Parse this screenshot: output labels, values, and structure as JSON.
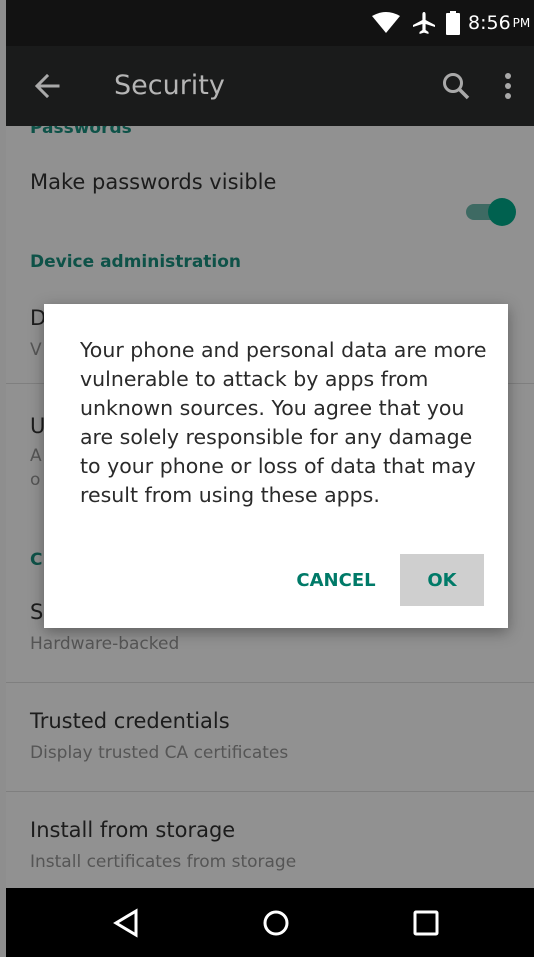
{
  "status_bar": {
    "time": "8:56",
    "ampm": "PM",
    "icons": [
      "wifi-icon",
      "airplane-mode-icon",
      "battery-icon"
    ]
  },
  "app_bar": {
    "title": "Security",
    "icons": [
      "back-arrow-icon",
      "search-icon",
      "more-vert-icon"
    ]
  },
  "settings": {
    "section_passwords": "Passwords",
    "make_passwords_visible": {
      "title": "Make passwords visible",
      "enabled": true
    },
    "section_device_admin": "Device administration",
    "device_admin_title_partial": "D",
    "device_admin_sub_partial": "V",
    "unknown_sources_title_partial": "U",
    "unknown_sources_sub_line1_partial": "A",
    "unknown_sources_sub_line2_partial": "o",
    "section_credential_partial": "C",
    "storage_type": {
      "title_partial": "S",
      "subtitle": "Hardware-backed"
    },
    "trusted_credentials": {
      "title": "Trusted credentials",
      "subtitle": "Display trusted CA certificates"
    },
    "install_from_storage": {
      "title": "Install from storage",
      "subtitle": "Install certificates from storage"
    }
  },
  "dialog": {
    "message": "Your phone and personal data are more vulnerable to attack by apps from unknown sources. You agree that you are solely responsible for any damage to your phone or loss of data that may result from using these apps.",
    "cancel_label": "CANCEL",
    "ok_label": "OK"
  },
  "nav_bar": {
    "icons": [
      "nav-back-icon",
      "nav-home-icon",
      "nav-recents-icon"
    ]
  },
  "colors": {
    "accent": "#009688",
    "status_bar": "#121212",
    "app_bar": "#1a1b1b",
    "dialog_background": "#ffffff"
  }
}
